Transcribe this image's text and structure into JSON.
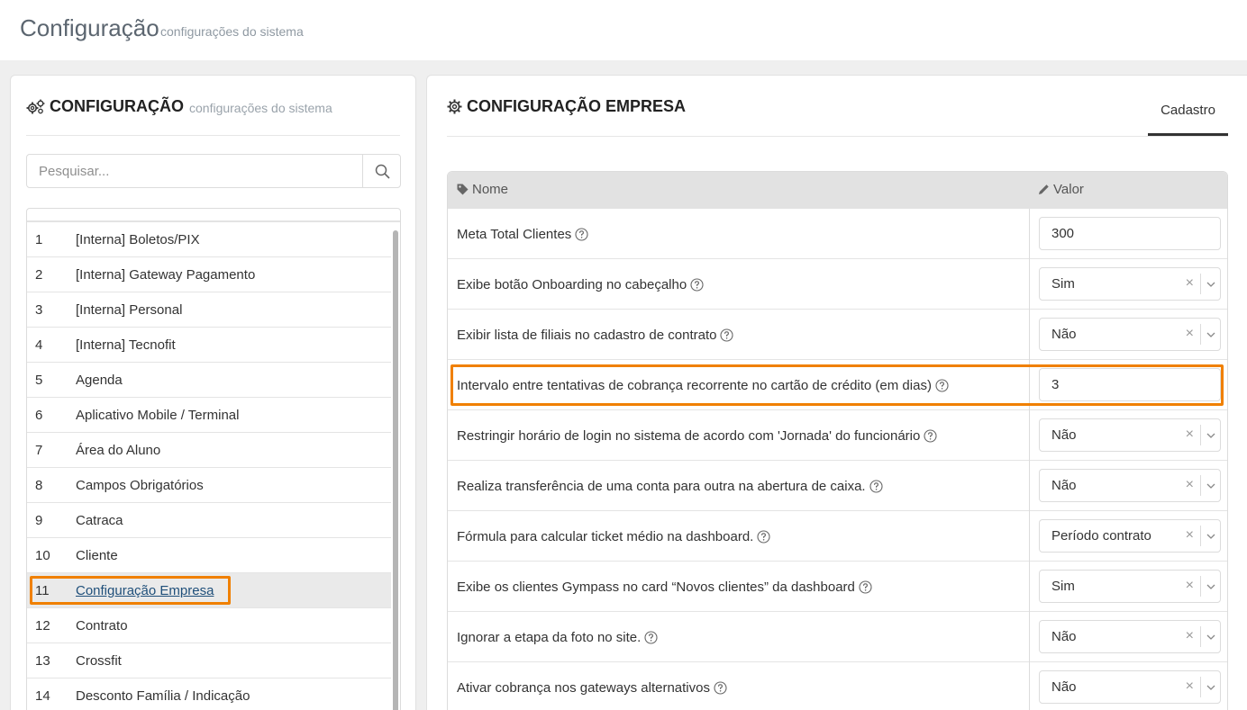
{
  "topbar": {
    "title": "Configuração",
    "subtitle": "configurações do sistema"
  },
  "left_panel": {
    "title": "CONFIGURAÇÃO",
    "subtitle": "configurações do sistema",
    "title_icon": "gears-icon",
    "search": {
      "placeholder": "Pesquisar...",
      "value": "",
      "icon": "search-icon"
    },
    "items": [
      {
        "num": "1",
        "label": "[Interna] Boletos/PIX"
      },
      {
        "num": "2",
        "label": "[Interna] Gateway Pagamento"
      },
      {
        "num": "3",
        "label": "[Interna] Personal"
      },
      {
        "num": "4",
        "label": "[Interna] Tecnofit"
      },
      {
        "num": "5",
        "label": "Agenda"
      },
      {
        "num": "6",
        "label": "Aplicativo Mobile / Terminal"
      },
      {
        "num": "7",
        "label": "Área do Aluno"
      },
      {
        "num": "8",
        "label": "Campos Obrigatórios"
      },
      {
        "num": "9",
        "label": "Catraca"
      },
      {
        "num": "10",
        "label": "Cliente"
      },
      {
        "num": "11",
        "label": "Configuração Empresa",
        "selected": true
      },
      {
        "num": "12",
        "label": "Contrato"
      },
      {
        "num": "13",
        "label": "Crossfit"
      },
      {
        "num": "14",
        "label": "Desconto Família / Indicação"
      }
    ]
  },
  "right_panel": {
    "title": "CONFIGURAÇÃO EMPRESA",
    "title_icon": "gear-icon",
    "tab": "Cadastro",
    "table": {
      "col_name": "Nome",
      "col_name_icon": "tag-icon",
      "col_value": "Valor",
      "col_value_icon": "pencil-icon",
      "rows": [
        {
          "name": "Meta Total Clientes",
          "type": "input",
          "value": "300"
        },
        {
          "name": "Exibe botão Onboarding no cabeçalho",
          "type": "select",
          "value": "Sim"
        },
        {
          "name": "Exibir lista de filiais no cadastro de contrato",
          "type": "select",
          "value": "Não"
        },
        {
          "name": "Intervalo entre tentativas de cobrança recorrente no cartão de crédito (em dias)",
          "type": "input",
          "value": "3",
          "highlighted": true
        },
        {
          "name": "Restringir horário de login no sistema de acordo com 'Jornada' do funcionário",
          "type": "select",
          "value": "Não"
        },
        {
          "name": "Realiza transferência de uma conta para outra na abertura de caixa.",
          "type": "select",
          "value": "Não"
        },
        {
          "name": "Fórmula para calcular ticket médio na dashboard.",
          "type": "select",
          "value": "Período contrato"
        },
        {
          "name": "Exibe os clientes Gympass no card “Novos clientes” da dashboard",
          "type": "select",
          "value": "Sim"
        },
        {
          "name": "Ignorar a etapa da foto no site.",
          "type": "select",
          "value": "Não"
        },
        {
          "name": "Ativar cobrança nos gateways alternativos",
          "type": "select",
          "value": "Não"
        }
      ]
    }
  },
  "colors": {
    "accent": "#f08000",
    "link": "#1f4f7a",
    "header_bg": "#e2e2e2"
  }
}
